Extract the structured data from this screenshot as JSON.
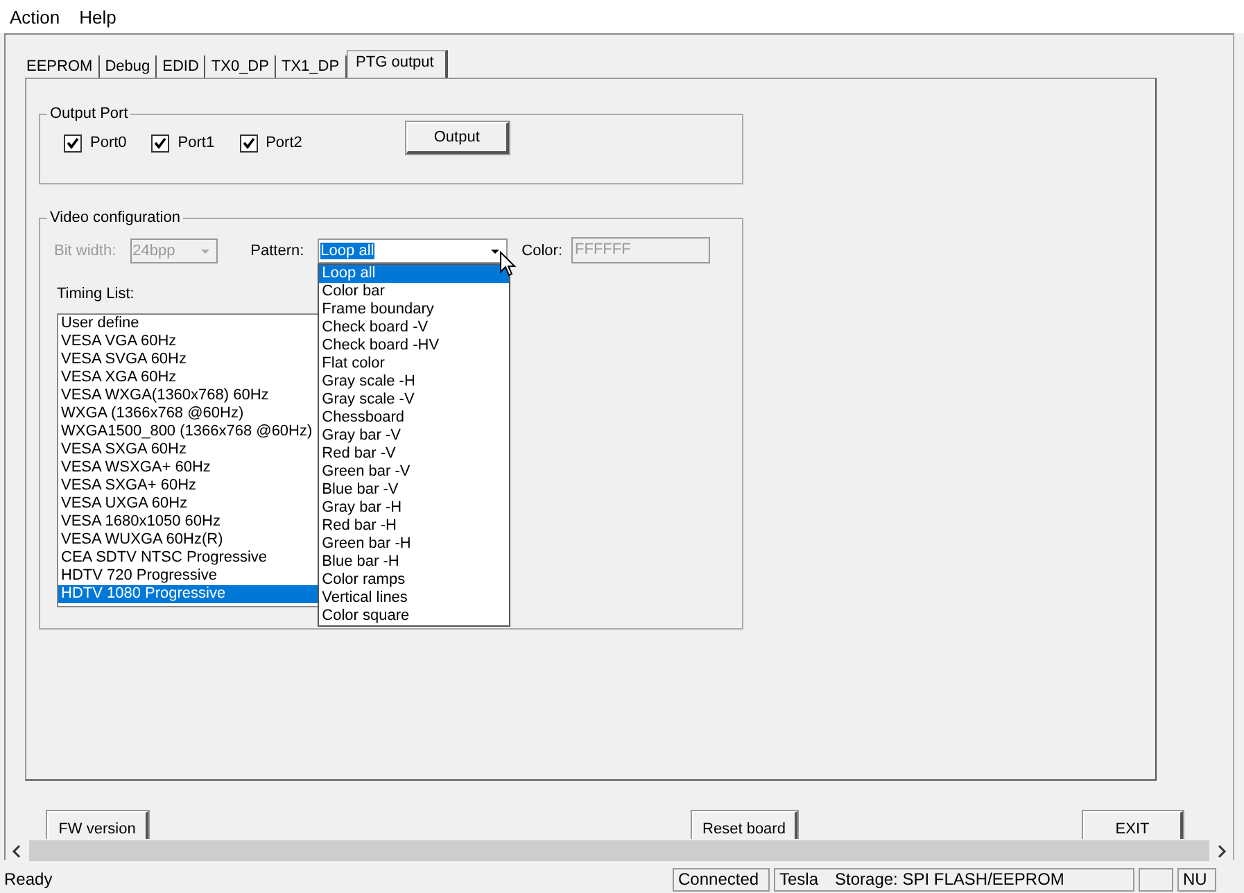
{
  "menu": [
    "Action",
    "Help"
  ],
  "tabs": [
    {
      "label": "EEPROM",
      "selected": false
    },
    {
      "label": "Debug",
      "selected": false
    },
    {
      "label": "EDID",
      "selected": false
    },
    {
      "label": "TX0_DP",
      "selected": false
    },
    {
      "label": "TX1_DP",
      "selected": false
    },
    {
      "label": "PTG output",
      "selected": true
    }
  ],
  "output_port": {
    "title": "Output Port",
    "ports": [
      {
        "label": "Port0",
        "checked": true
      },
      {
        "label": "Port1",
        "checked": true
      },
      {
        "label": "Port2",
        "checked": true
      }
    ],
    "button": "Output"
  },
  "video_config": {
    "title": "Video configuration",
    "bit_width": {
      "label": "Bit width:",
      "value": "24bpp",
      "disabled": true
    },
    "pattern": {
      "label": "Pattern:",
      "value": "Loop all",
      "expanded": true,
      "options": [
        {
          "label": "Loop all",
          "selected": true
        },
        {
          "label": "Color bar",
          "selected": false
        },
        {
          "label": "Frame boundary",
          "selected": false
        },
        {
          "label": "Check board -V",
          "selected": false
        },
        {
          "label": "Check board -HV",
          "selected": false
        },
        {
          "label": "Flat color",
          "selected": false
        },
        {
          "label": "Gray scale -H",
          "selected": false
        },
        {
          "label": "Gray scale -V",
          "selected": false
        },
        {
          "label": "Chessboard",
          "selected": false
        },
        {
          "label": "Gray bar -V",
          "selected": false
        },
        {
          "label": "Red bar -V",
          "selected": false
        },
        {
          "label": "Green bar -V",
          "selected": false
        },
        {
          "label": "Blue bar -V",
          "selected": false
        },
        {
          "label": "Gray bar -H",
          "selected": false
        },
        {
          "label": "Red bar -H",
          "selected": false
        },
        {
          "label": "Green bar -H",
          "selected": false
        },
        {
          "label": "Blue bar -H",
          "selected": false
        },
        {
          "label": "Color ramps",
          "selected": false
        },
        {
          "label": "Vertical lines",
          "selected": false
        },
        {
          "label": "Color square",
          "selected": false
        }
      ]
    },
    "color": {
      "label": "Color:",
      "value": "FFFFFF",
      "disabled": true
    },
    "timing_list": {
      "label": "Timing List:",
      "items": [
        {
          "label": "User define",
          "selected": false
        },
        {
          "label": "VESA VGA 60Hz",
          "selected": false
        },
        {
          "label": "VESA SVGA 60Hz",
          "selected": false
        },
        {
          "label": "VESA XGA 60Hz",
          "selected": false
        },
        {
          "label": "VESA WXGA(1360x768) 60Hz",
          "selected": false
        },
        {
          "label": "WXGA (1366x768 @60Hz)",
          "selected": false
        },
        {
          "label": "WXGA1500_800 (1366x768 @60Hz)",
          "selected": false
        },
        {
          "label": "VESA SXGA 60Hz",
          "selected": false
        },
        {
          "label": "VESA WSXGA+ 60Hz",
          "selected": false
        },
        {
          "label": "VESA SXGA+ 60Hz",
          "selected": false
        },
        {
          "label": "VESA UXGA 60Hz",
          "selected": false
        },
        {
          "label": "VESA 1680x1050 60Hz",
          "selected": false
        },
        {
          "label": "VESA WUXGA 60Hz(R)",
          "selected": false
        },
        {
          "label": "CEA SDTV NTSC Progressive",
          "selected": false
        },
        {
          "label": "HDTV 720 Progressive",
          "selected": false
        },
        {
          "label": "HDTV 1080 Progressive",
          "selected": true
        }
      ]
    }
  },
  "buttons": [
    "FW version",
    "Reset board",
    "EXIT"
  ],
  "status_bar": [
    "Ready",
    "Connected",
    "Tesla",
    "Storage: SPI FLASH/EEPROM",
    "NU"
  ]
}
